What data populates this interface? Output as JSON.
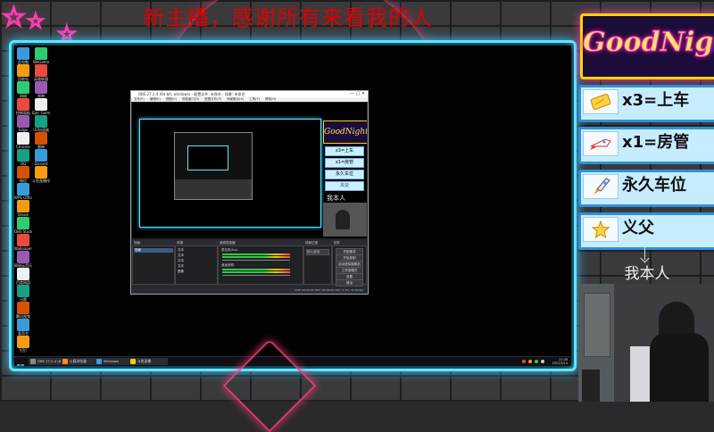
{
  "banner": "新主播，感谢所有来看我的人",
  "logo": {
    "brand": "GoodNight"
  },
  "gifts": [
    {
      "icon": "ticket-icon",
      "text": "x3=上车"
    },
    {
      "icon": "rocket-icon",
      "text": "x1=房管"
    },
    {
      "icon": "rocket-icon",
      "text": "永久车位"
    },
    {
      "icon": "star-icon",
      "text": "义父"
    }
  ],
  "me_label": "我本人",
  "obs": {
    "title": "OBS 27.2.4 (64-bit, windows) - 配置文件: 未命名 - 场景: 未命名",
    "menu": [
      "文件(F)",
      "编辑(E)",
      "视图(V)",
      "停靠窗口(D)",
      "配置文件(P)",
      "场景集合(S)",
      "工具(T)",
      "帮助(H)"
    ],
    "docks": [
      "场景",
      "来源",
      "音频混音器",
      "场景过渡",
      "控件"
    ],
    "scene_item": "场景",
    "sources": [
      "文本",
      "文本",
      "文本",
      "文本",
      "图像"
    ],
    "mixer_tracks": [
      "麦克风/Aux",
      "桌面音频"
    ],
    "transition": "淡入淡出",
    "controls": [
      "开始推流",
      "开始录制",
      "启动虚拟摄像机",
      "工作室模式",
      "设置",
      "退出"
    ],
    "status": "LIVE: 00:00:00  REC: 00:00:00  CPU: 5.3%, 30.00 fps"
  },
  "desktop_icons": [
    "此电脑",
    "回收站",
    "网络",
    "控制面板",
    "Edge",
    "Chrome",
    "QQ",
    "微信",
    "WPS Office",
    "Steam",
    "OBS Studio",
    "Wallpaper",
    "网易云音乐",
    "百度网盘",
    "迅雷",
    "腾讯视频",
    "爱奇艺",
    "钉钉",
    "WeGame",
    "英雄联盟",
    "原神",
    "Epic Games",
    "UU加速器",
    "雷神",
    "Discord",
    "斗鱼直播伴侣"
  ],
  "taskbar": {
    "items": [
      "OBS 27.2.4 (64-bit...)",
      "火狐浏览器",
      "Windows",
      "斗鱼直播"
    ],
    "time": "21:08",
    "date": "2022/5/14"
  },
  "colors": {
    "neon_blue": "#5fe6ff",
    "neon_pink": "#ff3db0",
    "banner_red": "#e00000",
    "gift_bg": "#c8ecff",
    "gift_border": "#2e90d8"
  }
}
